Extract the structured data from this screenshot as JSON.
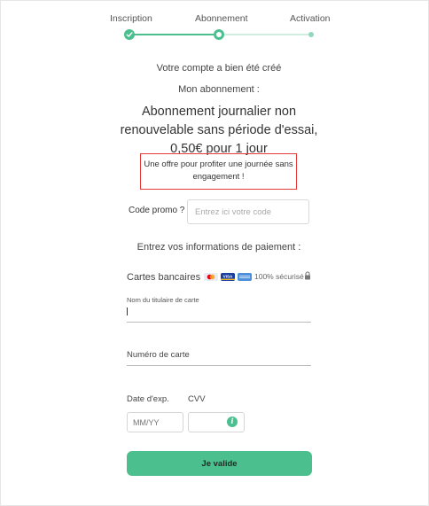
{
  "stepper": {
    "steps": [
      "Inscription",
      "Abonnement",
      "Activation"
    ],
    "current_step": 2,
    "colors": {
      "done": "#4cbf8f",
      "pending": "#8fd9b9",
      "track": "#cfeee0"
    }
  },
  "confirmation": {
    "account_created": "Votre compte a bien été créé",
    "subscription_heading": "Mon abonnement :"
  },
  "plan": {
    "title_lines": [
      "Abonnement journalier non",
      "renouvelable sans période d'essai,",
      "0,50€ pour 1 jour"
    ]
  },
  "offer": {
    "lines": [
      "Une offre pour profiter une journée sans",
      "engagement !"
    ],
    "border_color": "#e33a3a"
  },
  "promo": {
    "label": "Code promo ?",
    "placeholder": "Entrez ici votre code"
  },
  "payment": {
    "heading": "Entrez vos informations de paiement :",
    "cards_label": "Cartes bancaires",
    "card_icons": [
      "mastercard-icon",
      "visa-icon",
      "amex-icon"
    ],
    "secure_text": "100% sécurisé",
    "cardholder_label": "Nom du titulaire de carte",
    "card_number_label": "Numéro de carte",
    "expiry_label": "Date d'exp.",
    "cvv_label": "CVV",
    "expiry_placeholder": "MM/YY",
    "info_glyph": "i"
  },
  "submit": {
    "label": "Je valide",
    "color": "#4cbf8f"
  }
}
